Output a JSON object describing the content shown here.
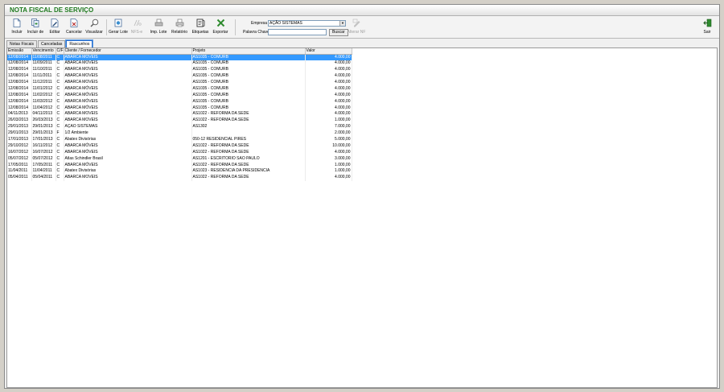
{
  "window": {
    "title": "NOTA FISCAL DE SERVIÇO"
  },
  "colors": {
    "title": "#1f7a1f",
    "selection": "#3399ff",
    "exit_icon": "#2e8b2e",
    "export_icon": "#2e8b2e"
  },
  "toolbar": {
    "buttons": [
      {
        "label": "Incluir",
        "icon": "new-document-icon",
        "enabled": true
      },
      {
        "label": "Incluir de",
        "icon": "copy-document-icon",
        "enabled": true
      },
      {
        "label": "Editar",
        "icon": "edit-document-icon",
        "enabled": true
      },
      {
        "label": "Cancelar",
        "icon": "cancel-document-icon",
        "enabled": true
      },
      {
        "label": "Visualizar",
        "icon": "magnifier-icon",
        "enabled": true
      },
      {
        "label": "Gerar Lote",
        "icon": "batch-icon",
        "enabled": true
      },
      {
        "label": "NFS-e",
        "icon": "nfse-icon",
        "enabled": false
      },
      {
        "label": "Imp. Lote",
        "icon": "print-batch-icon",
        "enabled": true
      },
      {
        "label": "Relatório",
        "icon": "report-icon",
        "enabled": true
      },
      {
        "label": "Etiquetas",
        "icon": "labels-icon",
        "enabled": true
      },
      {
        "label": "Exportar",
        "icon": "excel-export-icon",
        "enabled": true
      }
    ],
    "empresa_label": "Empresa",
    "empresa_value": "AÇÃO SISTEMAS",
    "palavra_chave_label": "Palavra Chave",
    "palavra_chave_value": "",
    "buscar_label": "Buscar",
    "alterar_nf_label": "Alterar NF",
    "sair_label": "Sair"
  },
  "tabs": [
    {
      "label": "Notas Fiscais",
      "active": false
    },
    {
      "label": "Canceladas",
      "active": false
    },
    {
      "label": "Rascunhos",
      "active": true
    }
  ],
  "grid": {
    "columns": [
      "Emissão",
      "Vencimento",
      "C/F",
      "Cliente / Fornecedor",
      "Projeto",
      "Valor"
    ],
    "rows": [
      [
        "12/08/2014",
        "11/08/2011",
        "C",
        "ABARCA MÓVEIS",
        "AS1035 - COMURB",
        "4.000,00"
      ],
      [
        "12/08/2014",
        "11/09/2011",
        "C",
        "ABARCA MÓVEIS",
        "AS1035 - COMURB",
        "4.000,00"
      ],
      [
        "12/08/2014",
        "11/10/2011",
        "C",
        "ABARCA MÓVEIS",
        "AS1035 - COMURB",
        "4.000,00"
      ],
      [
        "12/08/2014",
        "11/11/2011",
        "C",
        "ABARCA MÓVEIS",
        "AS1035 - COMURB",
        "4.000,00"
      ],
      [
        "12/08/2014",
        "11/12/2011",
        "C",
        "ABARCA MÓVEIS",
        "AS1035 - COMURB",
        "4.000,00"
      ],
      [
        "12/08/2014",
        "11/01/2012",
        "C",
        "ABARCA MÓVEIS",
        "AS1035 - COMURB",
        "4.000,00"
      ],
      [
        "12/08/2014",
        "11/02/2012",
        "C",
        "ABARCA MÓVEIS",
        "AS1035 - COMURB",
        "4.000,00"
      ],
      [
        "12/08/2014",
        "11/03/2012",
        "C",
        "ABARCA MÓVEIS",
        "AS1035 - COMURB",
        "4.000,00"
      ],
      [
        "12/08/2014",
        "11/04/2012",
        "C",
        "ABARCA MÓVEIS",
        "AS1035 - COMURB",
        "4.000,00"
      ],
      [
        "04/11/2013",
        "04/11/2013",
        "C",
        "ABARCA MÓVEIS",
        "AS1022 - REFORMA DA SEDE",
        "4.000,00"
      ],
      [
        "26/03/2013",
        "26/03/2013",
        "C",
        "ABARCA MÓVEIS",
        "AS1022 - REFORMA DA SEDE",
        "1.000,00"
      ],
      [
        "29/01/2013",
        "29/01/2013",
        "C",
        "AÇÃO SISTEMAS",
        "AS1302",
        "7.000,00"
      ],
      [
        "29/01/2013",
        "29/01/2013",
        "F",
        "1/2 Ambiente",
        "",
        "2.000,00"
      ],
      [
        "17/01/2013",
        "17/01/2013",
        "C",
        "Abatex Divisórias",
        "050-12 RESIDENCIAL PIRES",
        "5.000,00"
      ],
      [
        "29/10/2012",
        "16/11/2012",
        "C",
        "ABARCA MÓVEIS",
        "AS1022 - REFORMA DA SEDE",
        "10.000,00"
      ],
      [
        "16/07/2012",
        "16/07/2012",
        "C",
        "ABARCA MÓVEIS",
        "AS1022 - REFORMA DA SEDE",
        "4.000,00"
      ],
      [
        "05/07/2012",
        "05/07/2012",
        "C",
        "Atlas Schindler Brasil",
        "AS1201 - ESCRITORIO SAO PAULO",
        "3.000,00"
      ],
      [
        "17/05/2011",
        "17/05/2011",
        "C",
        "ABARCA MÓVEIS",
        "AS1022 - REFORMA DA SEDE",
        "1.000,00"
      ],
      [
        "11/04/2011",
        "11/04/2011",
        "C",
        "Abatex Divisórias",
        "AS1023 - RESIDENCIA DA PRESIDENCIA",
        "1.000,00"
      ],
      [
        "05/04/2011",
        "05/04/2011",
        "C",
        "ABARCA MÓVEIS",
        "AS1022 - REFORMA DA SEDE",
        "4.000,00"
      ]
    ],
    "selected_row": 0
  }
}
